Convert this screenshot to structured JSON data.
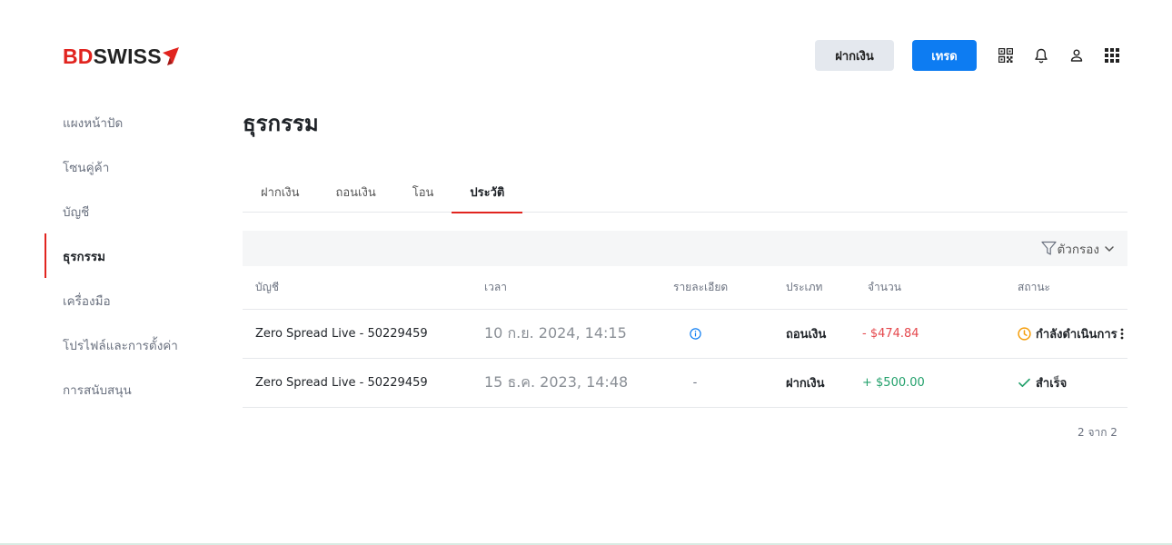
{
  "brand": {
    "part1": "BD",
    "part2": "SWISS",
    "accent_color": "#e1241f"
  },
  "topbar": {
    "deposit_label": "ฝากเงิน",
    "trade_label": "เทรด",
    "icons": [
      "qr-code-icon",
      "bell-icon",
      "user-icon",
      "apps-grid-icon"
    ]
  },
  "sidebar": {
    "items": [
      {
        "label": "แผงหน้าปัด",
        "active": false
      },
      {
        "label": "โซนคู่ค้า",
        "active": false
      },
      {
        "label": "บัญชี",
        "active": false
      },
      {
        "label": "ธุรกรรม",
        "active": true
      },
      {
        "label": "เครื่องมือ",
        "active": false
      },
      {
        "label": "โปรไฟล์และการตั้งค่า",
        "active": false
      },
      {
        "label": "การสนับสนุน",
        "active": false
      }
    ]
  },
  "page": {
    "title": "ธุรกรรม"
  },
  "tabs": [
    {
      "label": "ฝากเงิน",
      "active": false
    },
    {
      "label": "ถอนเงิน",
      "active": false
    },
    {
      "label": "โอน",
      "active": false
    },
    {
      "label": "ประวัติ",
      "active": true
    }
  ],
  "filter": {
    "label": "ตัวกรอง"
  },
  "table": {
    "headers": {
      "account": "บัญชี",
      "time": "เวลา",
      "details": "รายละเอียด",
      "type": "ประเภท",
      "amount": "จำนวน",
      "status": "สถานะ"
    },
    "rows": [
      {
        "account": "Zero Spread Live - 50229459",
        "time": "10 ก.ย. 2024, 14:15",
        "details": "info-icon",
        "type": "ถอนเงิน",
        "amount": "- $474.84",
        "status": "กำลังดำเนินการ",
        "status_icon": "clock-icon",
        "status_color": "#f59e0b"
      },
      {
        "account": "Zero Spread Live - 50229459",
        "time": "15 ธ.ค. 2023, 14:48",
        "details": "-",
        "type": "ฝากเงิน",
        "amount": "+ $500.00",
        "status": "สำเร็จ",
        "status_icon": "check-icon",
        "status_color": "#22a06b"
      }
    ]
  },
  "pagination": {
    "text": "2 จาก 2"
  }
}
